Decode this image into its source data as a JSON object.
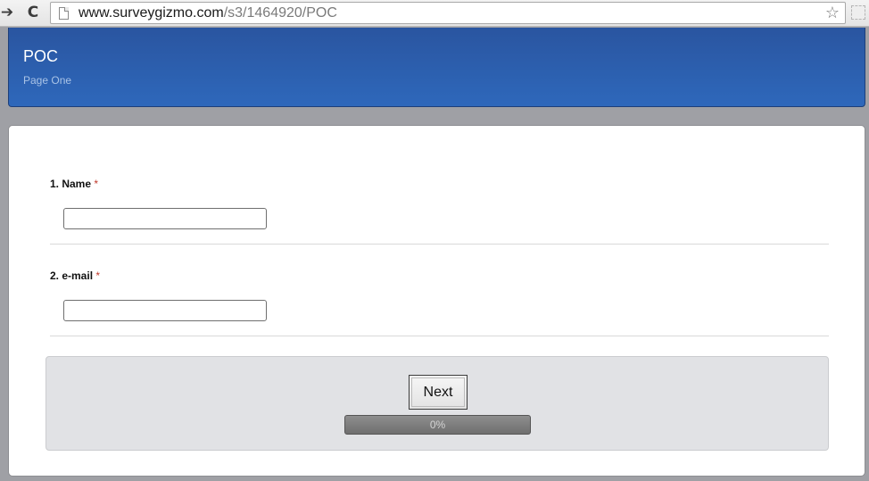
{
  "browser": {
    "forward_glyph": "➔",
    "reload_glyph": "C",
    "url_host": "www.surveygizmo.com",
    "url_path": "/s3/1464920/POC",
    "star_glyph": "☆",
    "icons": [
      "forward-arrow-icon",
      "reload-icon",
      "page-icon",
      "bookmark-star-icon",
      "extension-icon"
    ]
  },
  "header": {
    "title": "POC",
    "page_name": "Page One"
  },
  "questions": [
    {
      "number_label": "1. Name",
      "required_mark": "*",
      "value": "",
      "placeholder": ""
    },
    {
      "number_label": "2. e-mail",
      "required_mark": "*",
      "value": "",
      "placeholder": ""
    }
  ],
  "footer": {
    "next_label": "Next",
    "progress_text": "0%",
    "progress_value": 0
  },
  "colors": {
    "header_blue": "#2e68bb",
    "required_red": "#c0392b",
    "page_background": "#9fa0a5"
  }
}
